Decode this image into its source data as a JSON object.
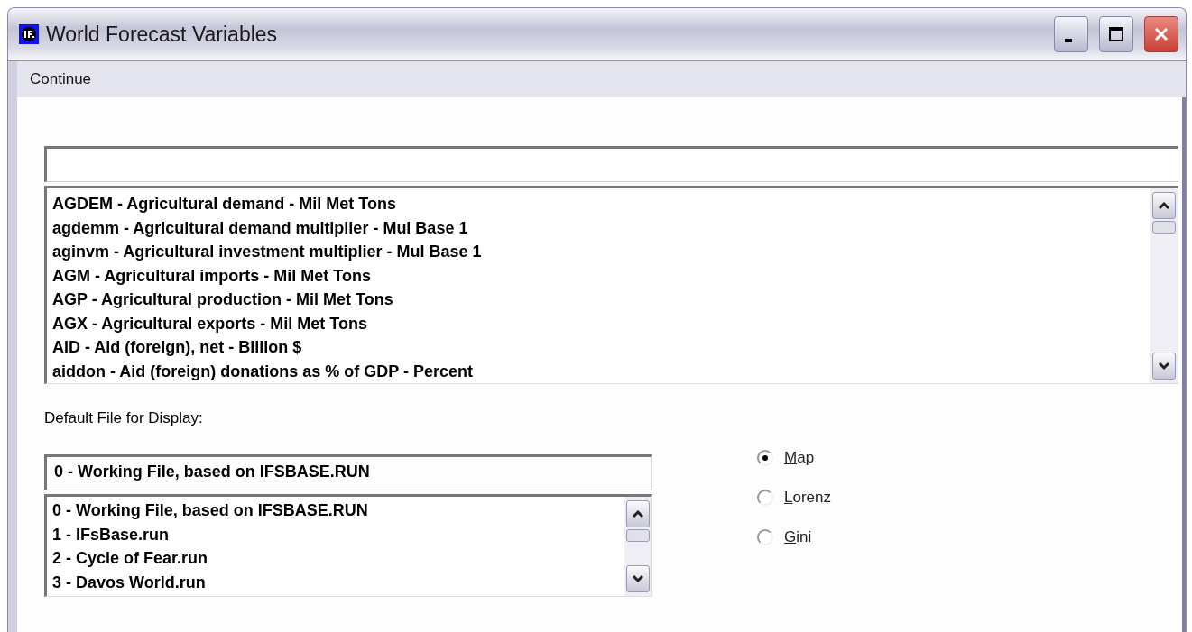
{
  "window": {
    "title": "World Forecast Variables"
  },
  "menu": [
    "Continue"
  ],
  "variables": [
    {
      "label": "AGDEM - Agricultural demand - Mil Met Tons"
    },
    {
      "label": "agdemm - Agricultural demand multiplier - Mul Base 1"
    },
    {
      "label": "aginvm - Agricultural investment multiplier - Mul Base 1"
    },
    {
      "label": "AGM - Agricultural imports - Mil Met Tons"
    },
    {
      "label": "AGP - Agricultural production - Mil Met Tons"
    },
    {
      "label": "AGX - Agricultural exports - Mil Met Tons"
    },
    {
      "label": "AID - Aid (foreign), net - Billion $"
    },
    {
      "label": "aiddon - Aid (foreign) donations as % of GDP - Percent"
    }
  ],
  "default_file": {
    "label": "Default File for Display:",
    "value": "0 - Working File, based on IFSBASE.RUN",
    "files": [
      {
        "label": "0 - Working File, based on IFSBASE.RUN"
      },
      {
        "label": "1 - IFsBase.run"
      },
      {
        "label": "2 - Cycle of Fear.run"
      },
      {
        "label": "3 - Davos World.run"
      }
    ]
  },
  "display_types": [
    {
      "label": "Map",
      "selected": true
    },
    {
      "label": "Lorenz",
      "selected": false
    },
    {
      "label": "Gini",
      "selected": false
    }
  ]
}
